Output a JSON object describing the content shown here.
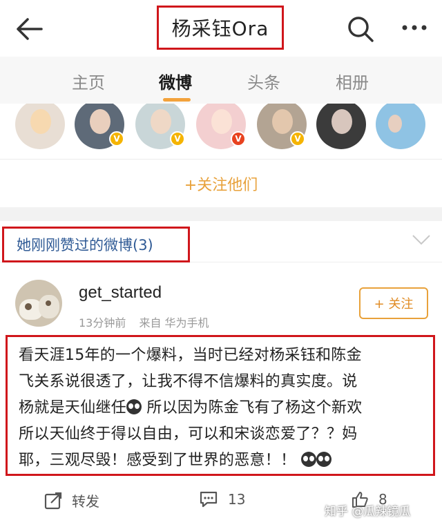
{
  "header": {
    "title": "杨采钰Ora"
  },
  "tabs": [
    {
      "label": "主页"
    },
    {
      "label": "微博"
    },
    {
      "label": "头条"
    },
    {
      "label": "相册"
    }
  ],
  "following": {
    "label": "+关注他们"
  },
  "liked": {
    "label": "她刚刚赞过的微博(3)"
  },
  "post": {
    "username": "get_started",
    "time": "13分钟前",
    "source": "来自 华为手机",
    "follow_label": "+ 关注",
    "lines": [
      "看天涯15年的一个爆料，当时已经对杨采钰和陈金",
      "飞关系说很透了，让我不得不信爆料的真实度。说",
      "杨就是天仙继任",
      "所以因为陈金飞有了杨这个新欢",
      "所以天仙终于得以自由，可以和宋谈恋爱了？？妈",
      "耶，三观尽毁！感受到了世界的恶意！！"
    ],
    "repost_label": "转发",
    "comment_count": "13",
    "like_count": "8"
  },
  "watermark": "知乎 @瓜辣镜瓜",
  "colors": {
    "accent": "#f3a23b",
    "highlight_box": "#d0161b",
    "link": "#2f5a95"
  }
}
